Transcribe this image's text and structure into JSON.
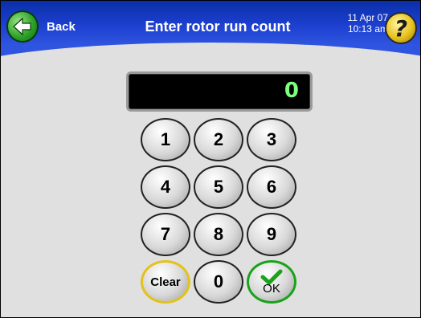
{
  "header": {
    "back_label": "Back",
    "title": "Enter rotor run count",
    "date": "11 Apr 07",
    "time": "10:13 am",
    "help_glyph": "?"
  },
  "display": {
    "value": "0"
  },
  "keypad": {
    "keys": [
      "1",
      "2",
      "3",
      "4",
      "5",
      "6",
      "7",
      "8",
      "9"
    ],
    "clear_label": "Clear",
    "zero_label": "0",
    "ok_label": "OK"
  },
  "icons": {
    "back": "left-arrow-icon",
    "help": "question-mark-icon",
    "ok": "checkmark-icon"
  },
  "colors": {
    "header_blue": "#1c3fcf",
    "display_digits": "#7dff7d",
    "clear_ring": "#e3c21a",
    "ok_ring": "#1aa31a",
    "back_green": "#2ea32a",
    "help_yellow": "#e6c21e"
  }
}
